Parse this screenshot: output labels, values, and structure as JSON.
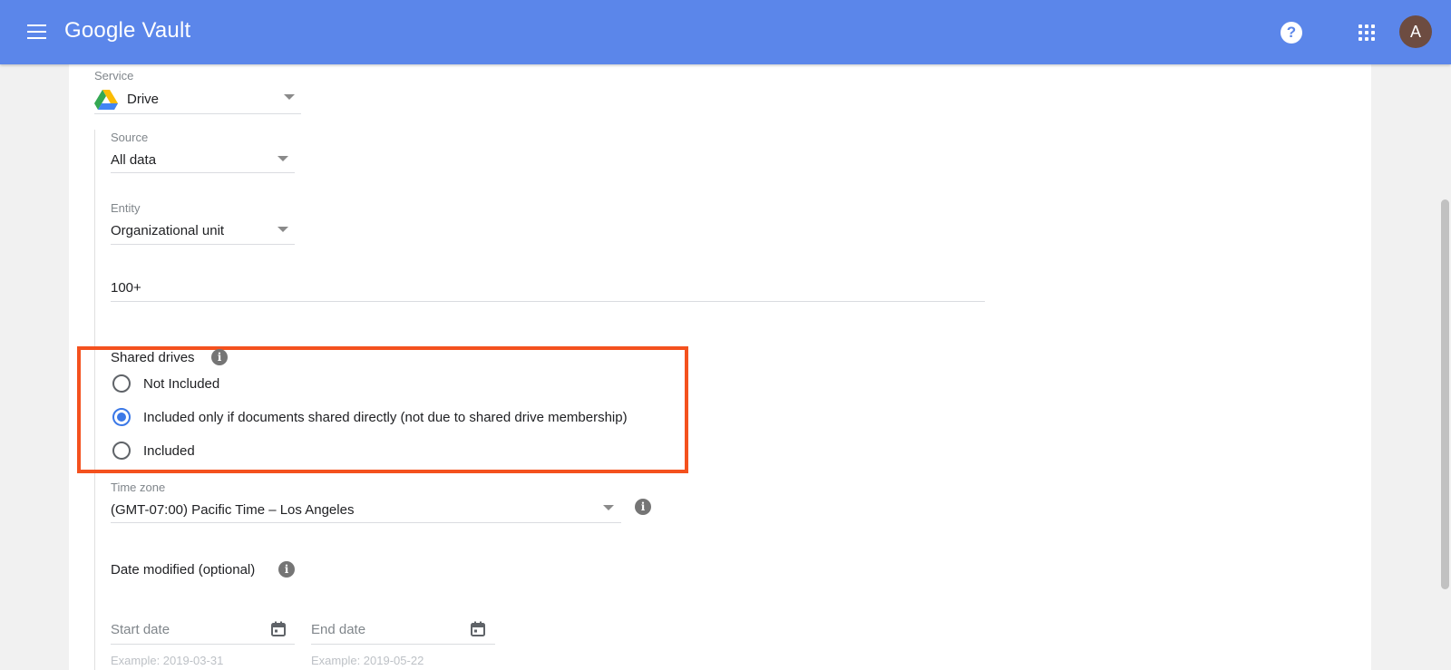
{
  "header": {
    "app_title": "Google Vault",
    "menu_icon": "menu-icon",
    "help_icon": "help-icon",
    "help_glyph": "?",
    "apps_icon": "apps-grid-icon",
    "avatar_initial": "A"
  },
  "form": {
    "service": {
      "label": "Service",
      "value": "Drive",
      "icon": "google-drive-icon"
    },
    "source": {
      "label": "Source",
      "value": "All data"
    },
    "entity": {
      "label": "Entity",
      "value": "Organizational unit"
    },
    "org_unit": {
      "value": "100+"
    },
    "shared_drives": {
      "label": "Shared drives",
      "info_glyph": "i",
      "options": [
        {
          "label": "Not Included",
          "checked": false
        },
        {
          "label": "Included only if documents shared directly (not due to shared drive membership)",
          "checked": true
        },
        {
          "label": "Included",
          "checked": false
        }
      ]
    },
    "time_zone": {
      "label": "Time zone",
      "value": "(GMT-07:00) Pacific Time – Los Angeles",
      "info_glyph": "i"
    },
    "date_modified": {
      "label": "Date modified (optional)",
      "info_glyph": "i",
      "start": {
        "placeholder": "Start date",
        "hint": "Example: 2019-03-31"
      },
      "end": {
        "placeholder": "End date",
        "hint": "Example: 2019-05-22"
      }
    }
  },
  "colors": {
    "header_bg": "#5b86ea",
    "highlight_border": "#f4511e",
    "radio_selected": "#3b78e7"
  }
}
